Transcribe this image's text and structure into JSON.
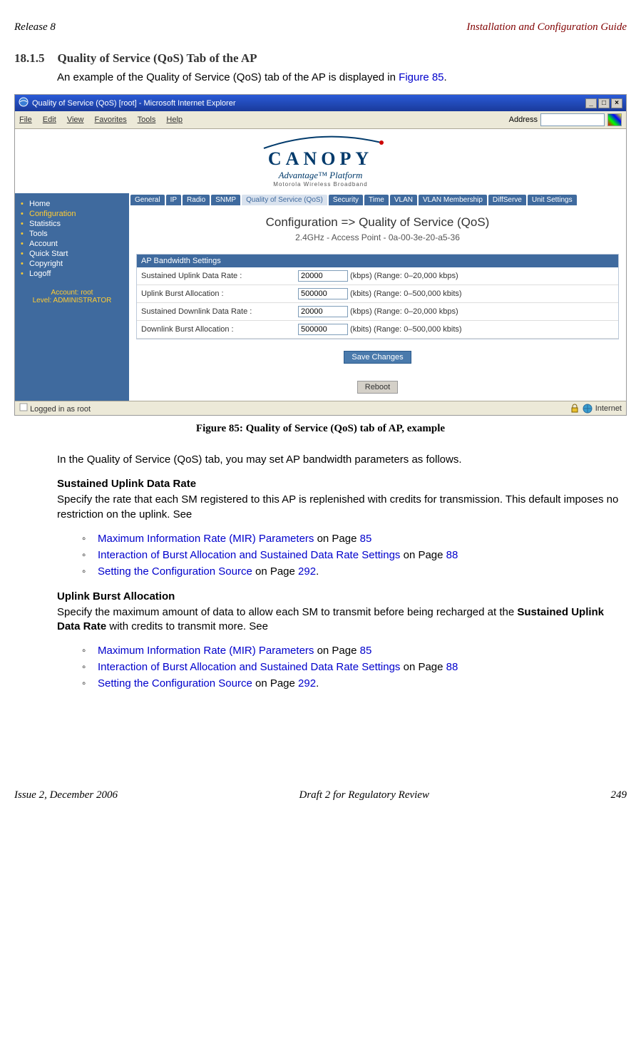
{
  "header": {
    "left": "Release 8",
    "right": "Installation and Configuration Guide"
  },
  "section": {
    "number": "18.1.5",
    "title": "Quality of Service (QoS) Tab of the AP"
  },
  "intro": {
    "text_a": "An example of the Quality of Service (QoS) tab of the AP is displayed in ",
    "link": "Figure 85",
    "text_b": "."
  },
  "screenshot": {
    "window_title": "Quality of Service (QoS) [root] - Microsoft Internet Explorer",
    "menus": [
      "File",
      "Edit",
      "View",
      "Favorites",
      "Tools",
      "Help"
    ],
    "address_label": "Address",
    "logo": {
      "name": "CANOPY",
      "sub": "Advantage™ Platform",
      "tag": "Motorola Wireless Broadband"
    },
    "sidebar_items": [
      {
        "label": "Home",
        "sel": false
      },
      {
        "label": "Configuration",
        "sel": true
      },
      {
        "label": "Statistics",
        "sel": false
      },
      {
        "label": "Tools",
        "sel": false
      },
      {
        "label": "Account",
        "sel": false
      },
      {
        "label": "Quick Start",
        "sel": false
      },
      {
        "label": "Copyright",
        "sel": false
      },
      {
        "label": "Logoff",
        "sel": false
      }
    ],
    "account_info": "Account: root\nLevel: ADMINISTRATOR",
    "tabs": [
      {
        "label": "General",
        "active": false
      },
      {
        "label": "IP",
        "active": false
      },
      {
        "label": "Radio",
        "active": false
      },
      {
        "label": "SNMP",
        "active": false
      },
      {
        "label": "Quality of Service (QoS)",
        "active": true
      },
      {
        "label": "Security",
        "active": false
      },
      {
        "label": "Time",
        "active": false
      },
      {
        "label": "VLAN",
        "active": false
      },
      {
        "label": "VLAN Membership",
        "active": false
      },
      {
        "label": "DiffServe",
        "active": false
      },
      {
        "label": "Unit Settings",
        "active": false
      }
    ],
    "config_header": "Configuration => Quality of Service (QoS)",
    "config_sub": "2.4GHz - Access Point - 0a-00-3e-20-a5-36",
    "settings_title": "AP Bandwidth Settings",
    "rows": [
      {
        "label": "Sustained Uplink Data Rate :",
        "value": "20000",
        "hint": "(kbps) (Range: 0–20,000 kbps)"
      },
      {
        "label": "Uplink Burst Allocation :",
        "value": "500000",
        "hint": "(kbits) (Range: 0–500,000 kbits)"
      },
      {
        "label": "Sustained Downlink Data Rate :",
        "value": "20000",
        "hint": "(kbps) (Range: 0–20,000 kbps)"
      },
      {
        "label": "Downlink Burst Allocation :",
        "value": "500000",
        "hint": "(kbits) (Range: 0–500,000 kbits)"
      }
    ],
    "save_btn": "Save Changes",
    "reboot_btn": "Reboot",
    "status_left": "Logged in as root",
    "status_right": "Internet"
  },
  "caption": "Figure 85: Quality of Service (QoS) tab of AP, example",
  "para1": "In the Quality of Service (QoS) tab, you may set AP bandwidth parameters as follows.",
  "sub1": {
    "title": "Sustained Uplink Data Rate",
    "text": "Specify the rate that each SM registered to this AP is replenished with credits for transmission. This default imposes no restriction on the uplink. See"
  },
  "bullets": [
    {
      "link": "Maximum Information Rate (MIR) Parameters",
      "post": " on Page ",
      "page": "85"
    },
    {
      "link": "Interaction of Burst Allocation and Sustained Data Rate Settings",
      "post": " on Page ",
      "page": "88"
    },
    {
      "link": "Setting the Configuration Source",
      "post": " on Page ",
      "page": "292",
      "tail": "."
    }
  ],
  "sub2": {
    "title": "Uplink Burst Allocation",
    "text_a": "Specify the maximum amount of data to allow each SM to transmit before being recharged at the ",
    "bold": "Sustained Uplink Data Rate",
    "text_b": " with credits to transmit more. See"
  },
  "footer": {
    "left": "Issue 2, December 2006",
    "center": "Draft 2 for Regulatory Review",
    "right": "249"
  }
}
